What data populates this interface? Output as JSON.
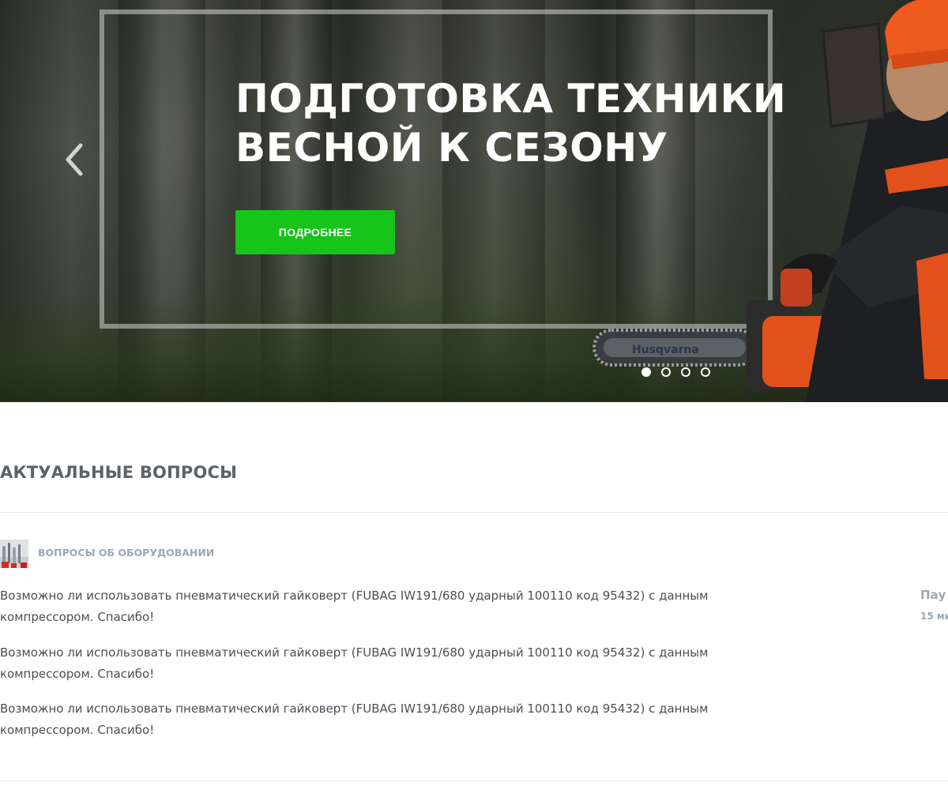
{
  "hero": {
    "title_line1": "ПОДГОТОВКА ТЕХНИКИ",
    "title_line2": "ВЕСНОЙ К СЕЗОНУ",
    "button_label": "ПОДРОБНЕЕ",
    "chainsaw_brand": "Husqvarna",
    "slides_total": 4,
    "active_slide": 1,
    "button_color": "#16c41a"
  },
  "section": {
    "title": "АКТУАЛЬНЫЕ ВОПРОСЫ"
  },
  "category": {
    "label": "ВОПРОСЫ ОБ ОБОРУДОВАНИИ",
    "icon": "tools-thumbnail-icon"
  },
  "questions": [
    {
      "text": "Возможно ли использовать пневматический гайковерт (FUBAG IW191/680 ударный 100110 код 95432) с данным компрессором. Спасибо!"
    },
    {
      "text": "Возможно ли использовать пневматический гайковерт (FUBAG IW191/680 ударный 100110 код 95432) с данным компрессором. Спасибо!"
    },
    {
      "text": "Возможно ли использовать пневматический гайковерт (FUBAG IW191/680 ударный 100110 код 95432) с данным компрессором. Спасибо!"
    }
  ],
  "meta": {
    "author": "Пау",
    "time": "15 ми"
  },
  "colors": {
    "accent_green": "#16c41a",
    "muted_text": "#9ca8b6",
    "heading": "#5d6268",
    "body_text": "#4a4f55"
  }
}
